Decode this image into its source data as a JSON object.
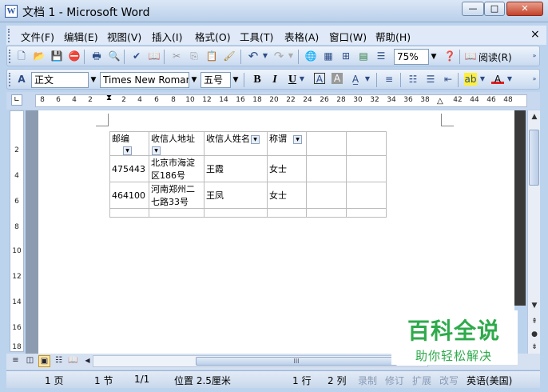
{
  "window": {
    "title": "文档 1 - Microsoft Word",
    "min_glyph": "—",
    "max_glyph": "□",
    "close_glyph": "✕"
  },
  "menubar": {
    "items": [
      "文件(F)",
      "编辑(E)",
      "视图(V)",
      "插入(I)",
      "格式(O)",
      "工具(T)",
      "表格(A)",
      "窗口(W)",
      "帮助(H)"
    ],
    "close_glyph": "×"
  },
  "toolbar_standard": {
    "zoom": "75%",
    "read_label": "阅读(R)"
  },
  "toolbar_format": {
    "style": "正文",
    "font": "Times New Roman",
    "size": "五号",
    "bold": "B",
    "italic": "I",
    "underline": "U"
  },
  "ruler": {
    "numbers": [
      "8",
      "6",
      "4",
      "2",
      "2",
      "4",
      "6",
      "8",
      "10",
      "12",
      "14",
      "16",
      "18",
      "20",
      "22",
      "24",
      "26",
      "28",
      "30",
      "32",
      "34",
      "36",
      "38",
      "42",
      "44",
      "46",
      "48"
    ]
  },
  "vertical_ruler": {
    "numbers": [
      "2",
      "4",
      "6",
      "8",
      "10",
      "12",
      "14",
      "16",
      "18"
    ]
  },
  "table": {
    "headers": [
      "邮编",
      "收信人地址",
      "收信人姓名",
      "称谓",
      "",
      ""
    ],
    "rows": [
      [
        "475443",
        "北京市海淀区186号",
        "王霞",
        "女士",
        "",
        ""
      ],
      [
        "464100",
        "河南郑州二七路33号",
        "王凤",
        "女士",
        "",
        ""
      ],
      [
        "",
        "",
        "",
        "",
        "",
        ""
      ]
    ]
  },
  "scroll": {
    "hthumb_glyph": "III"
  },
  "statusbar": {
    "page": "1 页",
    "section": "1 节",
    "pages": "1/1",
    "position": "位置 2.5厘米",
    "line": "1 行",
    "column": "2 列",
    "rec": "录制",
    "trk": "修订",
    "ext": "扩展",
    "ovr": "改写",
    "language": "英语(美国)"
  },
  "watermark": {
    "main": "百科全说",
    "sub": "助你轻松解决"
  },
  "colors": {
    "accent": "#2a56a5",
    "watermark": "#2eaa4b"
  }
}
